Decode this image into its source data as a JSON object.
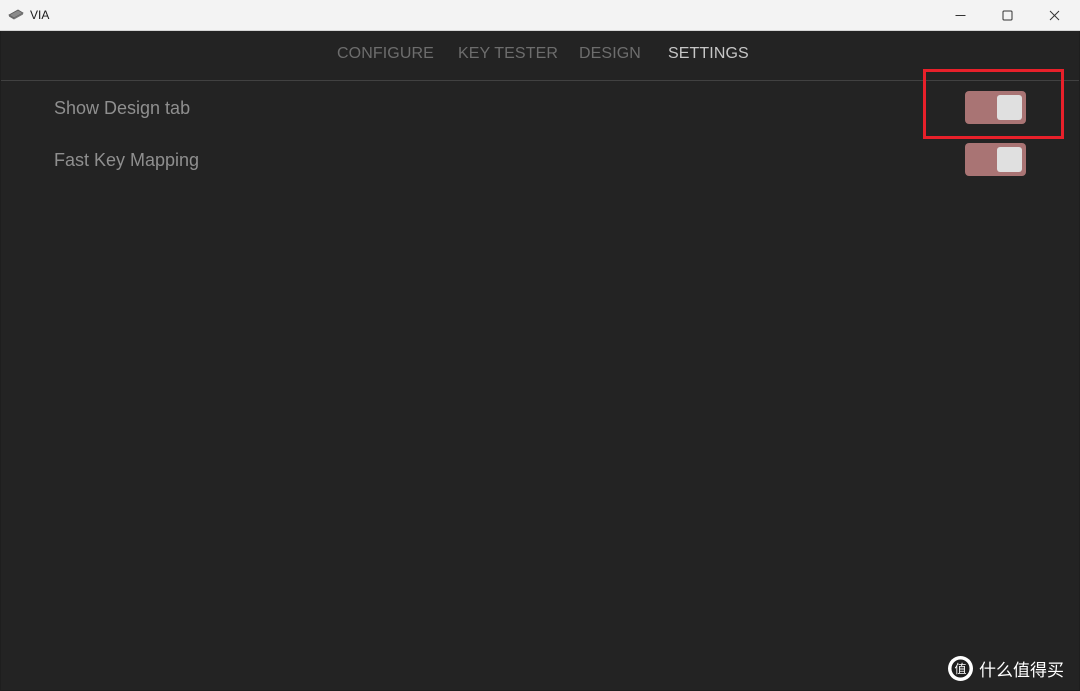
{
  "window": {
    "title": "VIA",
    "app_icon": "keyboard-icon",
    "controls": [
      "minimize-icon",
      "maximize-icon",
      "close-icon"
    ]
  },
  "nav": {
    "tabs": [
      {
        "label": "CONFIGURE",
        "active": false
      },
      {
        "label": "KEY TESTER",
        "active": false
      },
      {
        "label": "DESIGN",
        "active": false
      },
      {
        "label": "SETTINGS",
        "active": true
      }
    ]
  },
  "settings": {
    "items": [
      {
        "label": "Show Design tab",
        "enabled": true,
        "highlighted": true
      },
      {
        "label": "Fast Key Mapping",
        "enabled": true,
        "highlighted": false
      }
    ]
  },
  "colors": {
    "toggle_on": "#a97474",
    "knob": "#e0e0e0",
    "highlight": "#e8202a",
    "active_tab": "#c6c6c6",
    "inactive_tab": "#6d6d6d"
  },
  "watermark": {
    "logo": "zhi-logo",
    "text": "什么值得买"
  }
}
